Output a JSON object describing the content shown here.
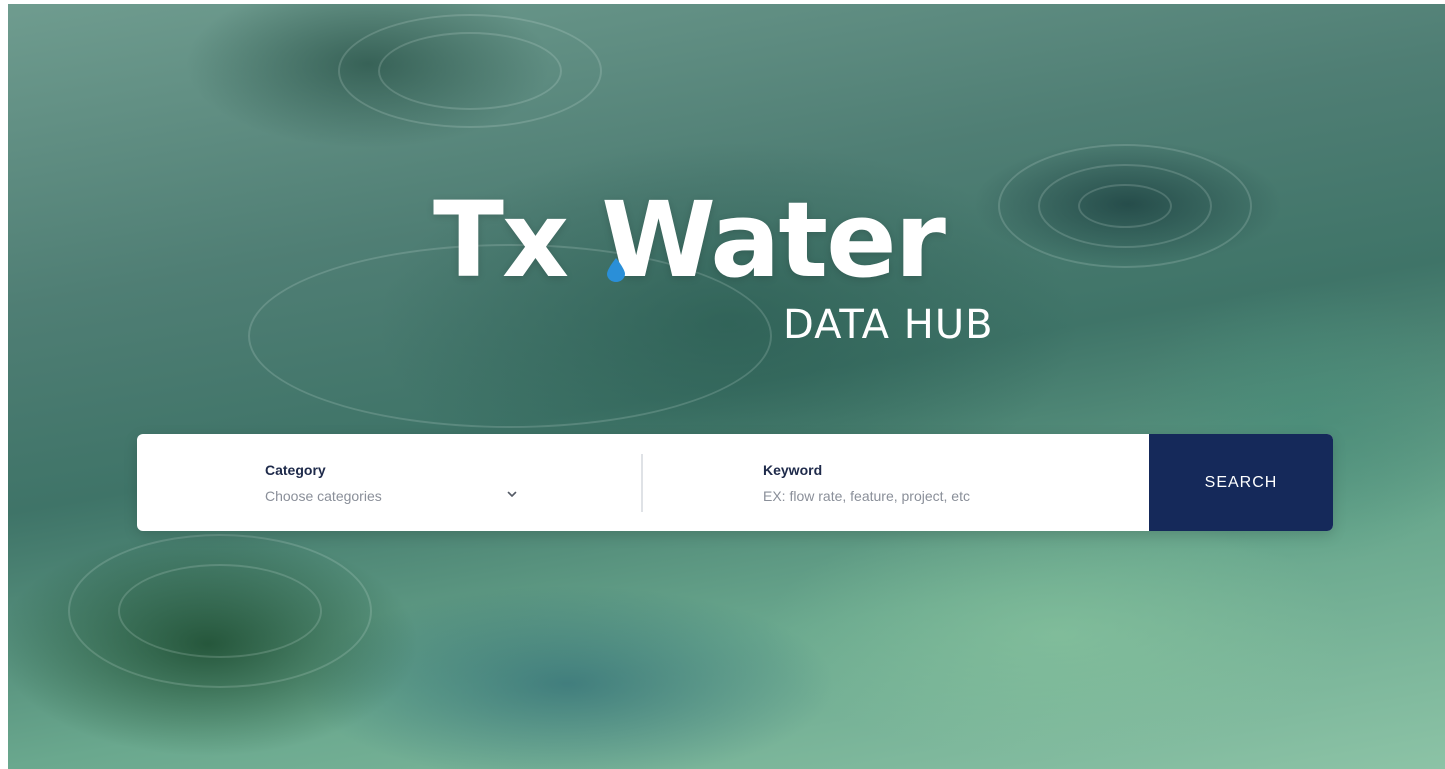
{
  "logo": {
    "brand": "Tx Water",
    "subtitle": "DATA HUB"
  },
  "search": {
    "category_label": "Category",
    "category_value": "Choose categories",
    "keyword_label": "Keyword",
    "keyword_placeholder": "EX: flow rate, feature, project, etc",
    "button_label": "SEARCH"
  },
  "colors": {
    "button_bg": "#15295a",
    "logo_text": "#ffffff",
    "drop_accent": "#2a8fd8"
  },
  "icons": {
    "dropdown": "chevron-down-icon",
    "logo_drop": "water-drop-icon"
  }
}
